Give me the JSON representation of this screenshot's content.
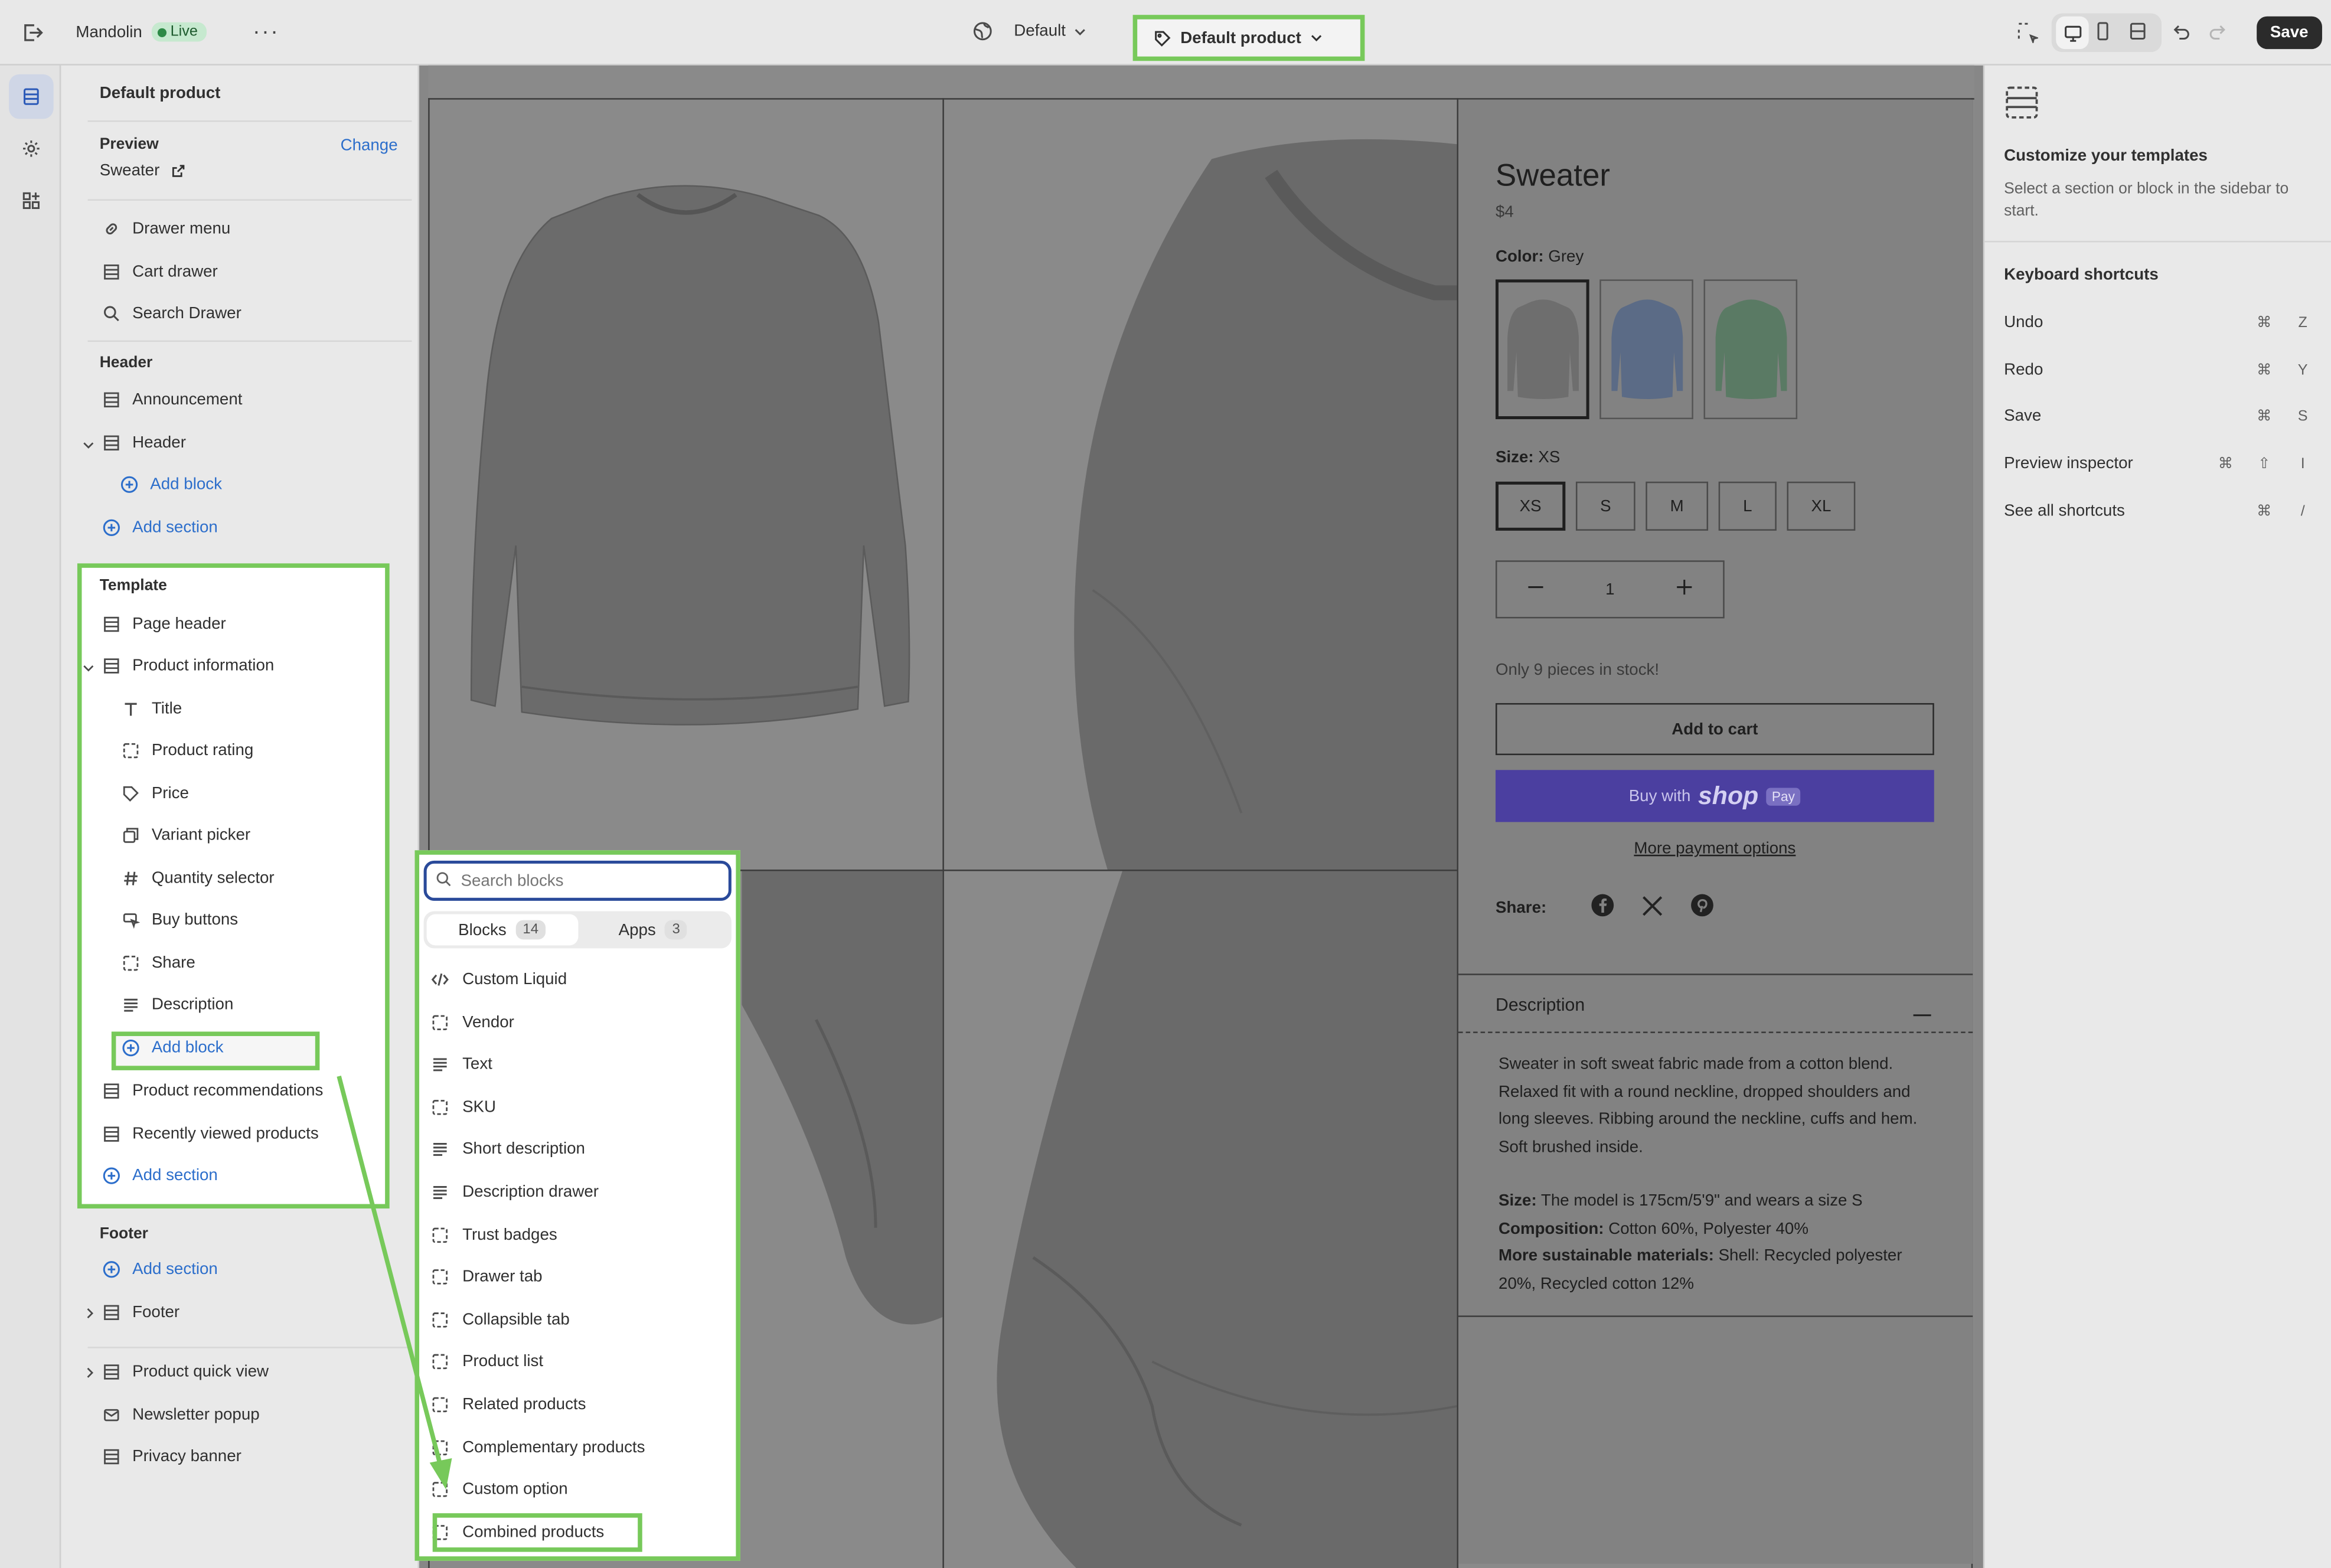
{
  "topbar": {
    "store_name": "Mandolin",
    "status_badge": "Live",
    "theme_label": "Default",
    "template_label": "Default product",
    "save_label": "Save"
  },
  "sidebar": {
    "title": "Default product",
    "preview_label": "Preview",
    "change_label": "Change",
    "preview_product": "Sweater",
    "overlay_items": [
      "Drawer menu",
      "Cart drawer",
      "Search Drawer"
    ],
    "header_group_label": "Header",
    "header_items": [
      "Announcement",
      "Header"
    ],
    "header_add_block": "Add block",
    "header_add_section": "Add section",
    "template_label": "Template",
    "template_items": {
      "page_header": "Page header",
      "product_information": "Product information",
      "blocks": [
        "Title",
        "Product rating",
        "Price",
        "Variant picker",
        "Quantity selector",
        "Buy buttons",
        "Share",
        "Description"
      ],
      "add_block": "Add block",
      "product_recommendations": "Product recommendations",
      "recently_viewed": "Recently viewed products",
      "add_section": "Add section"
    },
    "footer_group_label": "Footer",
    "footer_add_section": "Add section",
    "footer_item": "Footer",
    "overlay_bottom": [
      "Product quick view",
      "Newsletter popup",
      "Privacy banner"
    ]
  },
  "product": {
    "title": "Sweater",
    "price": "$4",
    "color_label": "Color:",
    "color_value": "Grey",
    "swatch_colors": [
      "#6e6e6e",
      "#5b6b86",
      "#5a7a64"
    ],
    "size_label": "Size:",
    "size_value": "XS",
    "sizes": [
      "XS",
      "S",
      "M",
      "L",
      "XL"
    ],
    "quantity": "1",
    "stock_note": "Only 9 pieces in stock!",
    "add_to_cart": "Add to cart",
    "buy_with": "Buy with",
    "shop_word": "shop",
    "pay_word": "Pay",
    "more_payment": "More payment options",
    "share_label": "Share:",
    "description_title": "Description",
    "description_text": "Sweater in soft sweat fabric made from a cotton blend. Relaxed fit with a round neckline, dropped shoulders and long sleeves. Ribbing around the neckline, cuffs and hem. Soft brushed inside.",
    "size_detail_label": "Size:",
    "size_detail": "The model is 175cm/5'9\" and wears a size S",
    "composition_label": "Composition:",
    "composition": "Cotton 60%, Polyester 40%",
    "sustainable_label": "More sustainable materials:",
    "sustainable": "Shell: Recycled polyester 20%, Recycled cotton 12%"
  },
  "block_picker": {
    "search_placeholder": "Search blocks",
    "tab_blocks": "Blocks",
    "tab_blocks_count": "14",
    "tab_apps": "Apps",
    "tab_apps_count": "3",
    "items": [
      "Custom Liquid",
      "Vendor",
      "Text",
      "SKU",
      "Short description",
      "Description drawer",
      "Trust badges",
      "Drawer tab",
      "Collapsible tab",
      "Product list",
      "Related products",
      "Complementary products",
      "Custom option",
      "Combined products"
    ],
    "item_icons": [
      "code-icon",
      "block-icon",
      "text-icon",
      "block-icon",
      "text-icon",
      "text-icon",
      "block-icon",
      "block-icon",
      "block-icon",
      "block-icon",
      "block-icon",
      "block-icon",
      "block-icon",
      "block-icon"
    ]
  },
  "right_panel": {
    "customize_title": "Customize your templates",
    "customize_text": "Select a section or block in the sidebar to start.",
    "shortcuts_title": "Keyboard shortcuts",
    "shortcuts": [
      {
        "name": "Undo",
        "keys": [
          "⌘",
          "Z"
        ]
      },
      {
        "name": "Redo",
        "keys": [
          "⌘",
          "Y"
        ]
      },
      {
        "name": "Save",
        "keys": [
          "⌘",
          "S"
        ]
      },
      {
        "name": "Preview inspector",
        "keys": [
          "⌘",
          "⇧",
          "I"
        ]
      },
      {
        "name": "See all shortcuts",
        "keys": [
          "⌘",
          "/"
        ]
      }
    ]
  },
  "colors": {
    "accent_link": "#2c6ecb",
    "highlight": "#77c95a",
    "shop_pay": "#4b3fa0"
  }
}
